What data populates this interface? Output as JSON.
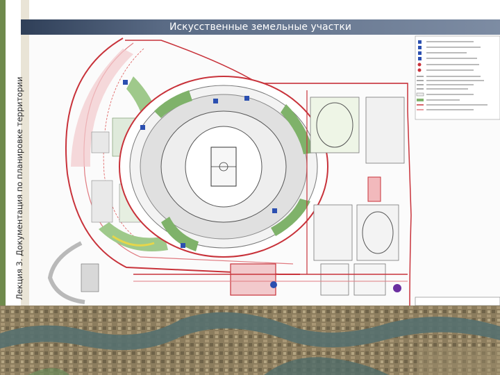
{
  "slide": {
    "title": "Искусственные земельные участки",
    "side_label": "Лекция 3. Документация по планировке территории"
  },
  "colors": {
    "title_bar": "#3f5069",
    "side_accent": "#6f8a4c",
    "road_red": "#c8323a",
    "green_area": "#7fb26a",
    "parking_blue": "#2b4fb0"
  },
  "icons": [
    "parking-icon",
    "compass-icon",
    "legend-icon"
  ]
}
